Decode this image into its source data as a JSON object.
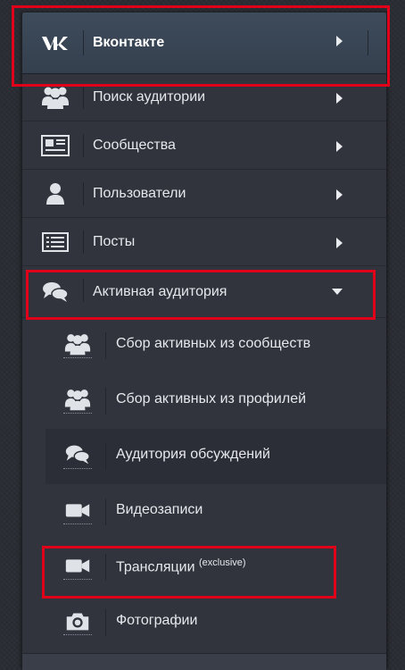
{
  "menu": {
    "top": {
      "label": "Вконтакте",
      "icon": "vk-logo-icon"
    },
    "items": [
      {
        "label": "Поиск аудитории",
        "icon": "group-icon",
        "expanded": false
      },
      {
        "label": "Сообщества",
        "icon": "newspaper-icon",
        "expanded": false
      },
      {
        "label": "Пользователи",
        "icon": "user-icon",
        "expanded": false
      },
      {
        "label": "Посты",
        "icon": "list-icon",
        "expanded": false
      },
      {
        "label": "Активная аудитория",
        "icon": "chat-bubbles-icon",
        "expanded": true
      }
    ],
    "subitems": [
      {
        "label": "Сбор активных из сообществ",
        "icon": "group-icon"
      },
      {
        "label": "Сбор активных из профилей",
        "icon": "group-icon"
      },
      {
        "label": "Аудитория обсуждений",
        "icon": "chat-bubbles-icon",
        "highlighted": true
      },
      {
        "label": "Видеозаписи",
        "icon": "video-camera-icon"
      },
      {
        "label": "Трансляции",
        "badge": "(exclusive)",
        "icon": "video-camera-icon"
      },
      {
        "label": "Фотографии",
        "icon": "photo-camera-icon"
      }
    ]
  },
  "colors": {
    "annotation": "#e0001a",
    "panel": "#31343d",
    "header": "#3e4b5b"
  }
}
